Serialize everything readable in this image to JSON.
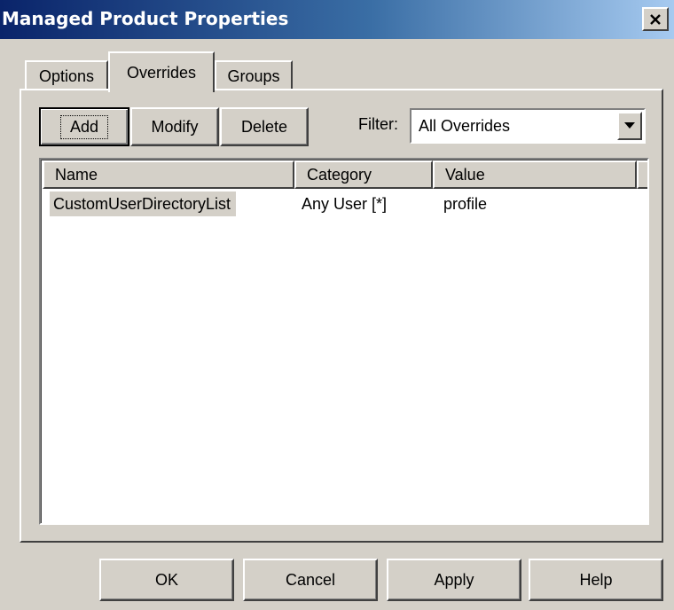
{
  "window": {
    "title": "Managed Product Properties"
  },
  "tabs": [
    {
      "label": "Options",
      "selected": false
    },
    {
      "label": "Overrides",
      "selected": true
    },
    {
      "label": "Groups",
      "selected": false
    }
  ],
  "toolbar": {
    "add_label": "Add",
    "modify_label": "Modify",
    "delete_label": "Delete"
  },
  "filter": {
    "label": "Filter:",
    "value": "All Overrides"
  },
  "list": {
    "columns": [
      "Name",
      "Category",
      "Value"
    ],
    "rows": [
      {
        "name": "CustomUserDirectoryList",
        "category": "Any User [*]",
        "value": "profile"
      }
    ]
  },
  "footer": {
    "ok_label": "OK",
    "cancel_label": "Cancel",
    "apply_label": "Apply",
    "help_label": "Help"
  },
  "icons": {
    "close": "close-icon",
    "dropdown": "chevron-down-icon"
  },
  "colors": {
    "title_start": "#0a246a",
    "title_end": "#a6caf0",
    "face": "#d4d0c8"
  }
}
